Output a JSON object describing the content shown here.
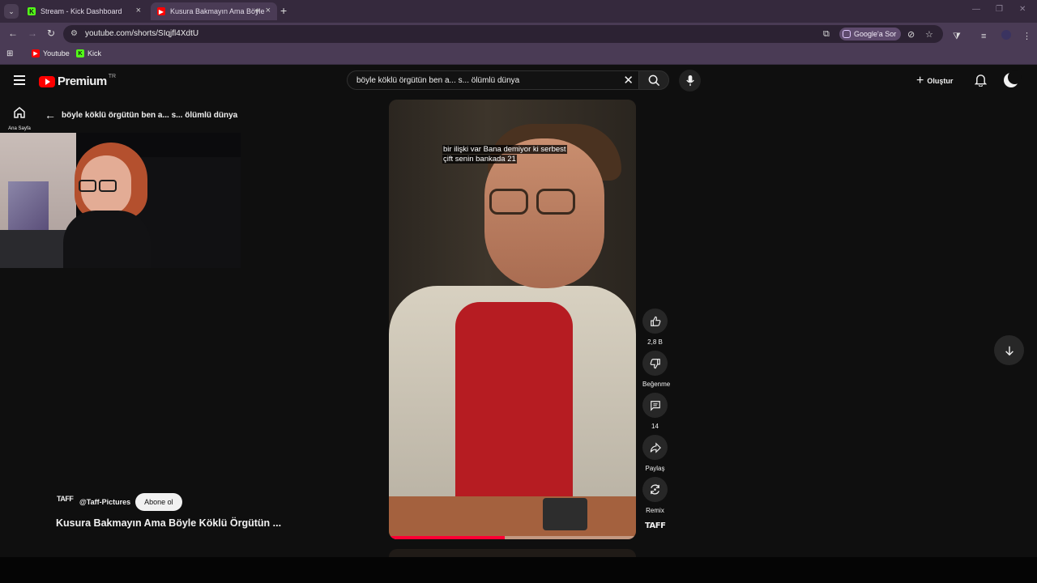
{
  "browser": {
    "tabs": [
      {
        "title": "Stream - Kick Dashboard",
        "icon": "kick-icon"
      },
      {
        "title": "Kusura Bakmayın Ama Böyle",
        "icon": "youtube-icon",
        "audio": true
      }
    ],
    "url": "youtube.com/shorts/SIqjfl4XdtU",
    "google_ask": "Google'a Sor",
    "bookmarks": [
      {
        "label": "Youtube",
        "icon": "youtube-icon"
      },
      {
        "label": "Kick",
        "icon": "kick-icon"
      }
    ]
  },
  "youtube": {
    "logo_word": "Premium",
    "logo_region": "TR",
    "search_query": "böyle köklü örgütün ben a... s... ölümlü dünya",
    "create_label": "Oluştur",
    "home_label": "Ana Sayfa",
    "back_title": "böyle köklü örgütün ben a... s... ölümlü dünya"
  },
  "video": {
    "caption_line1": "bir ilişki var Bana demiyor ki serbest",
    "caption_line2": "çift senin bankada 21",
    "progress_percent": 47,
    "channel_avatar": "TAFF",
    "channel_name": "@Taff-Pictures",
    "subscribe_label": "Abone ol",
    "title": "Kusura Bakmayın Ama Böyle Köklü Örgütün ..."
  },
  "actions": {
    "like_count": "2,8 B",
    "dislike_label": "Beğenme",
    "comment_count": "14",
    "share_label": "Paylaş",
    "remix_label": "Remix",
    "avatar_text": "TAFF"
  }
}
